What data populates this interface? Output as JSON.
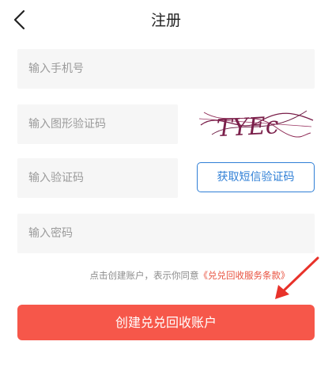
{
  "header": {
    "title": "注册"
  },
  "form": {
    "phone_placeholder": "输入手机号",
    "image_code_placeholder": "输入图形验证码",
    "captcha_text": "TYEc",
    "sms_code_placeholder": "输入验证码",
    "sms_button_label": "获取短信验证码",
    "password_placeholder": "输入密码"
  },
  "agreement": {
    "prefix": "点击创建账户，表示你同意",
    "link": "《兑兑回收服务条款》"
  },
  "submit_label": "创建兑兑回收账户",
  "colors": {
    "accent": "#f6574a",
    "link_blue": "#2f7fd6",
    "arrow_red": "#e8322a"
  }
}
